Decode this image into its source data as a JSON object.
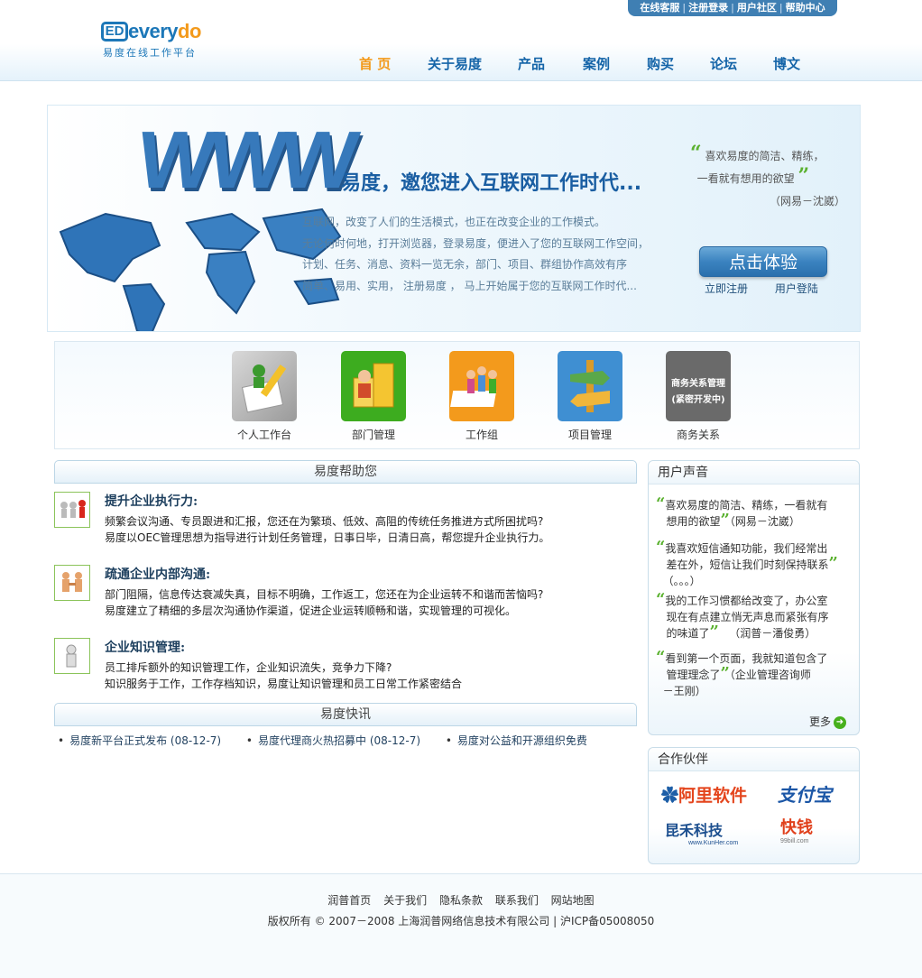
{
  "header": {
    "toplinks": [
      "在线客服",
      "注册登录",
      "用户社区",
      "帮助中心"
    ],
    "logo_mark": "ED",
    "logo_word_a": "every",
    "logo_word_b": "do",
    "logo_sub": "易度在线工作平台",
    "nav": [
      "首 页",
      "关于易度",
      "产品",
      "案例",
      "购买",
      "论坛",
      "博文"
    ]
  },
  "banner": {
    "www": "WWW",
    "title": "易度，邀您进入互联网工作时代...",
    "lines": [
      "互联网，改变了人们的生活模式，也正在改变企业的工作模式。",
      "无论何时何地，打开浏览器，登录易度，便进入了您的互联网工作空间，",
      "计划、任务、消息、资料一览无余，部门、项目、群组协作高效有序",
      "简单、易用、实用，  注册易度 ， 马上开始属于您的互联网工作时代..."
    ],
    "quote_line1": "喜欢易度的简洁、精练，",
    "quote_line2": "一看就有想用的欲望",
    "quote_author": "（网易－沈崴）",
    "experience_button": "点击体验",
    "register_link": "立即注册",
    "login_link": "用户登陆"
  },
  "modules": [
    {
      "label": "个人工作台",
      "icon": "personal-desk-icon",
      "color": "#b9b9b9"
    },
    {
      "label": "部门管理",
      "icon": "department-icon",
      "color": "#3dac1f"
    },
    {
      "label": "工作组",
      "icon": "workgroup-icon",
      "color": "#f39a1c"
    },
    {
      "label": "项目管理",
      "icon": "project-icon",
      "color": "#3f8fd2"
    },
    {
      "label": "商务关系",
      "icon": "business-relation-icon",
      "color": "#6a6a6a",
      "badge_line1": "商务关系管理",
      "badge_line2": "(紧密开发中)"
    }
  ],
  "help": {
    "heading": "易度帮助您",
    "items": [
      {
        "title": "提升企业执行力:",
        "line1": "频繁会议沟通、专员跟进和汇报，您还在为繁琐、低效、高阻的传统任务推进方式所困扰吗?",
        "line2": "易度以OEC管理思想为指导进行计划任务管理，日事日毕，日清日高，帮您提升企业执行力。"
      },
      {
        "title": "疏通企业内部沟通:",
        "line1": "部门阻隔，信息传达衰减失真，目标不明确，工作返工，您还在为企业运转不和谐而苦恼吗?",
        "line2": "易度建立了精细的多层次沟通协作渠道，促进企业运转顺畅和谐，实现管理的可视化。"
      },
      {
        "title": "企业知识管理:",
        "line1": "员工排斥额外的知识管理工作，企业知识流失，竞争力下降?",
        "line2": "知识服务于工作，工作存档知识，易度让知识管理和员工日常工作紧密结合"
      }
    ]
  },
  "news": {
    "heading": "易度快讯",
    "items": [
      "易度新平台正式发布 (08-12-7)",
      "易度代理商火热招募中 (08-12-7)",
      "易度对公益和开源组织免费"
    ]
  },
  "voices": {
    "heading": "用户声音",
    "items": [
      {
        "text1": "喜欢易度的简洁、精练，一看就有",
        "text2": "想用的欲望",
        "text3": "（网易－沈崴）"
      },
      {
        "text1": "我喜欢短信通知功能，我们经常出",
        "text2": "差在外，短信让我们时刻保持联系",
        "text3": "（。。。）"
      },
      {
        "text1": "我的工作习惯都给改变了，办公室",
        "text2": "现在有点建立悄无声息而紧张有序",
        "text3": "的味道了",
        "text4": "（润普－潘俊勇）"
      },
      {
        "text1": "看到第一个页面，我就知道包含了",
        "text2": "管理理念了",
        "text3": "（企业管理咨询师",
        "text4": "－王刚）"
      }
    ],
    "more": "更多"
  },
  "partners": {
    "heading": "合作伙伴",
    "items": [
      "阿里软件",
      "支付宝",
      "昆禾科技",
      "www.KunHer.com",
      "快钱",
      "99bill.com"
    ]
  },
  "footer": {
    "links": [
      "润普首页",
      "关于我们",
      "隐私条款",
      "联系我们",
      "网站地图"
    ],
    "copyright": "版权所有 © 2007－2008 上海润普网络信息技术有限公司 | 沪ICP备05008050"
  }
}
